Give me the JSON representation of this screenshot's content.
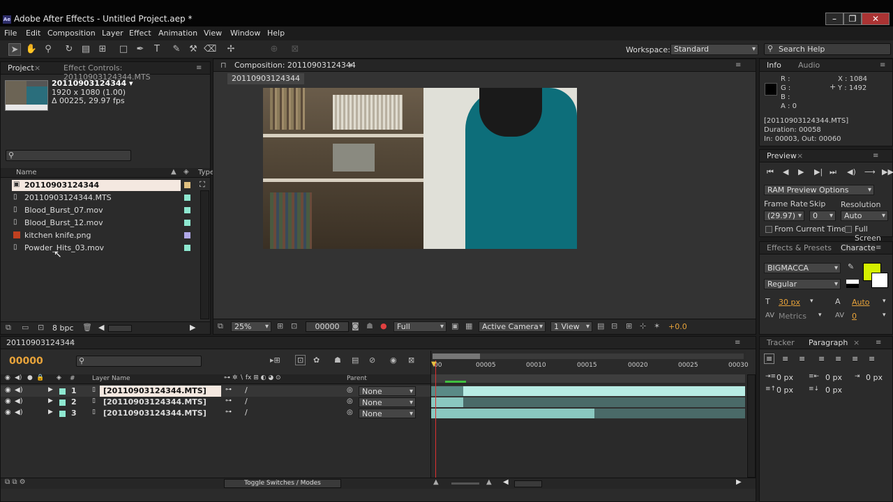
{
  "window": {
    "title": "Adobe After Effects - Untitled Project.aep *",
    "icon": "Ae"
  },
  "menu": [
    "File",
    "Edit",
    "Composition",
    "Layer",
    "Effect",
    "Animation",
    "View",
    "Window",
    "Help"
  ],
  "toolbar": {
    "workspace_label": "Workspace:",
    "workspace_value": "Standard",
    "search_placeholder": "Search Help"
  },
  "project": {
    "tab": "Project",
    "effect_tab": "Effect Controls: 20110903124344.MTS",
    "item_name": "20110903124344 ▾",
    "item_size": "1920 x 1080 (1.00)",
    "item_duration": "Δ 00225, 29.97 fps",
    "col_name": "Name",
    "col_type": "Type",
    "items": [
      {
        "name": "20110903124344",
        "color": "#e0c080",
        "icon": "comp"
      },
      {
        "name": "20110903124344.MTS",
        "color": "#8ee8d0",
        "icon": "footage"
      },
      {
        "name": "Blood_Burst_07.mov",
        "color": "#8ee8d0",
        "icon": "footage"
      },
      {
        "name": "Blood_Burst_12.mov",
        "color": "#8ee8d0",
        "icon": "footage"
      },
      {
        "name": "kitchen knife.png",
        "color": "#b0a8e8",
        "icon": "image"
      },
      {
        "name": "Powder_Hits_03.mov",
        "color": "#8ee8d0",
        "icon": "footage"
      }
    ],
    "bpc": "8 bpc"
  },
  "composition": {
    "tab": "Composition: 20110903124344",
    "subtab": "20110903124344",
    "zoom": "25%",
    "timecode": "00000",
    "resolution": "Full",
    "camera": "Active Camera",
    "views": "1 View",
    "exposure": "+0.0"
  },
  "info": {
    "tab": "Info",
    "audio_tab": "Audio",
    "r": "R :",
    "g": "G :",
    "b": "B :",
    "a": "A : 0",
    "x": "X : 1084",
    "y": "Y : 1492",
    "file": "[20110903124344.MTS]",
    "duration": "Duration: 00058",
    "inout": "In: 00003, Out: 00060"
  },
  "preview": {
    "tab": "Preview",
    "ram": "RAM Preview Options",
    "frame_rate_label": "Frame Rate",
    "skip_label": "Skip",
    "resolution_label": "Resolution",
    "frame_rate": "(29.97)",
    "skip": "0",
    "resolution": "Auto",
    "from_current": "From Current Time",
    "full_screen": "Full Screen"
  },
  "character": {
    "effects_tab": "Effects & Presets",
    "char_tab": "Characte",
    "font": "BIGMACCA",
    "style": "Regular",
    "size": "30 px",
    "leading": "Auto",
    "kerning": "Metrics",
    "tracking": "0",
    "fill_color": "#d4f000"
  },
  "paragraph": {
    "tracker_tab": "Tracker",
    "para_tab": "Paragraph",
    "v1": "0 px",
    "v2": "0 px",
    "v3": "0 px",
    "v4": "0 px",
    "v5": "0 px"
  },
  "timeline": {
    "tab": "20110903124344",
    "timecode": "00000",
    "col_layer": "Layer Name",
    "col_parent": "Parent",
    "col_num": "#",
    "ruler": [
      "00005",
      "00010",
      "00015",
      "00020",
      "00025",
      "00030"
    ],
    "layers": [
      {
        "num": "1",
        "name": "[20110903124344.MTS]",
        "parent": "None",
        "bar_start": 0.1,
        "bar_end": 1.0
      },
      {
        "num": "2",
        "name": "[20110903124344.MTS]",
        "parent": "None",
        "bar_start": 0.0,
        "bar_end": 0.1
      },
      {
        "num": "3",
        "name": "[20110903124344.MTS]",
        "parent": "None",
        "bar_start": 0.0,
        "bar_end": 0.52
      }
    ],
    "toggle": "Toggle Switches / Modes"
  }
}
